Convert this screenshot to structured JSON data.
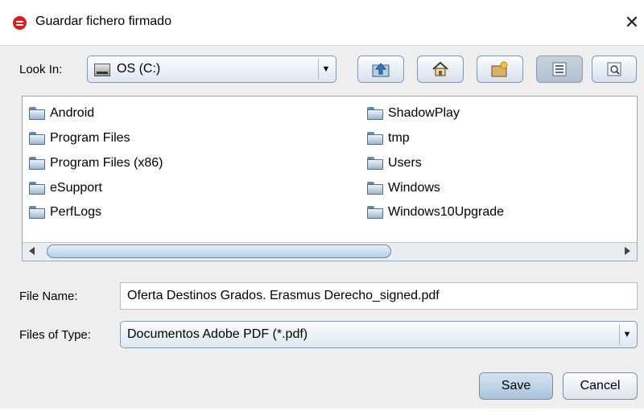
{
  "window": {
    "title": "Guardar fichero firmado",
    "close_glyph": "✕",
    "app_icon": "adobe-sign-icon"
  },
  "look_in": {
    "label": "Look In:",
    "value": "OS (C:)",
    "icon": "drive-icon"
  },
  "toolbar": {
    "buttons": [
      {
        "name": "up-one-level",
        "icon": "folder-up-icon"
      },
      {
        "name": "home",
        "icon": "home-icon"
      },
      {
        "name": "create-new-folder",
        "icon": "new-folder-icon"
      },
      {
        "name": "list-view",
        "icon": "list-view-icon",
        "pressed": true
      },
      {
        "name": "details-view",
        "icon": "details-view-icon"
      }
    ]
  },
  "files": {
    "column1": [
      "Android",
      "Program Files",
      "Program Files (x86)",
      "eSupport",
      "PerfLogs"
    ],
    "column2": [
      "ShadowPlay",
      "tmp",
      "Users",
      "Windows",
      "Windows10Upgrade"
    ]
  },
  "file_name": {
    "label": "File Name:",
    "value": "Oferta Destinos Grados. Erasmus Derecho_signed.pdf"
  },
  "file_type": {
    "label": "Files of Type:",
    "value": "Documentos Adobe PDF (*.pdf)"
  },
  "buttons": {
    "save": "Save",
    "cancel": "Cancel"
  },
  "colors": {
    "accent": "#7a9abb",
    "selected_button": "#a9c3dc",
    "app_icon": "#d42020"
  }
}
